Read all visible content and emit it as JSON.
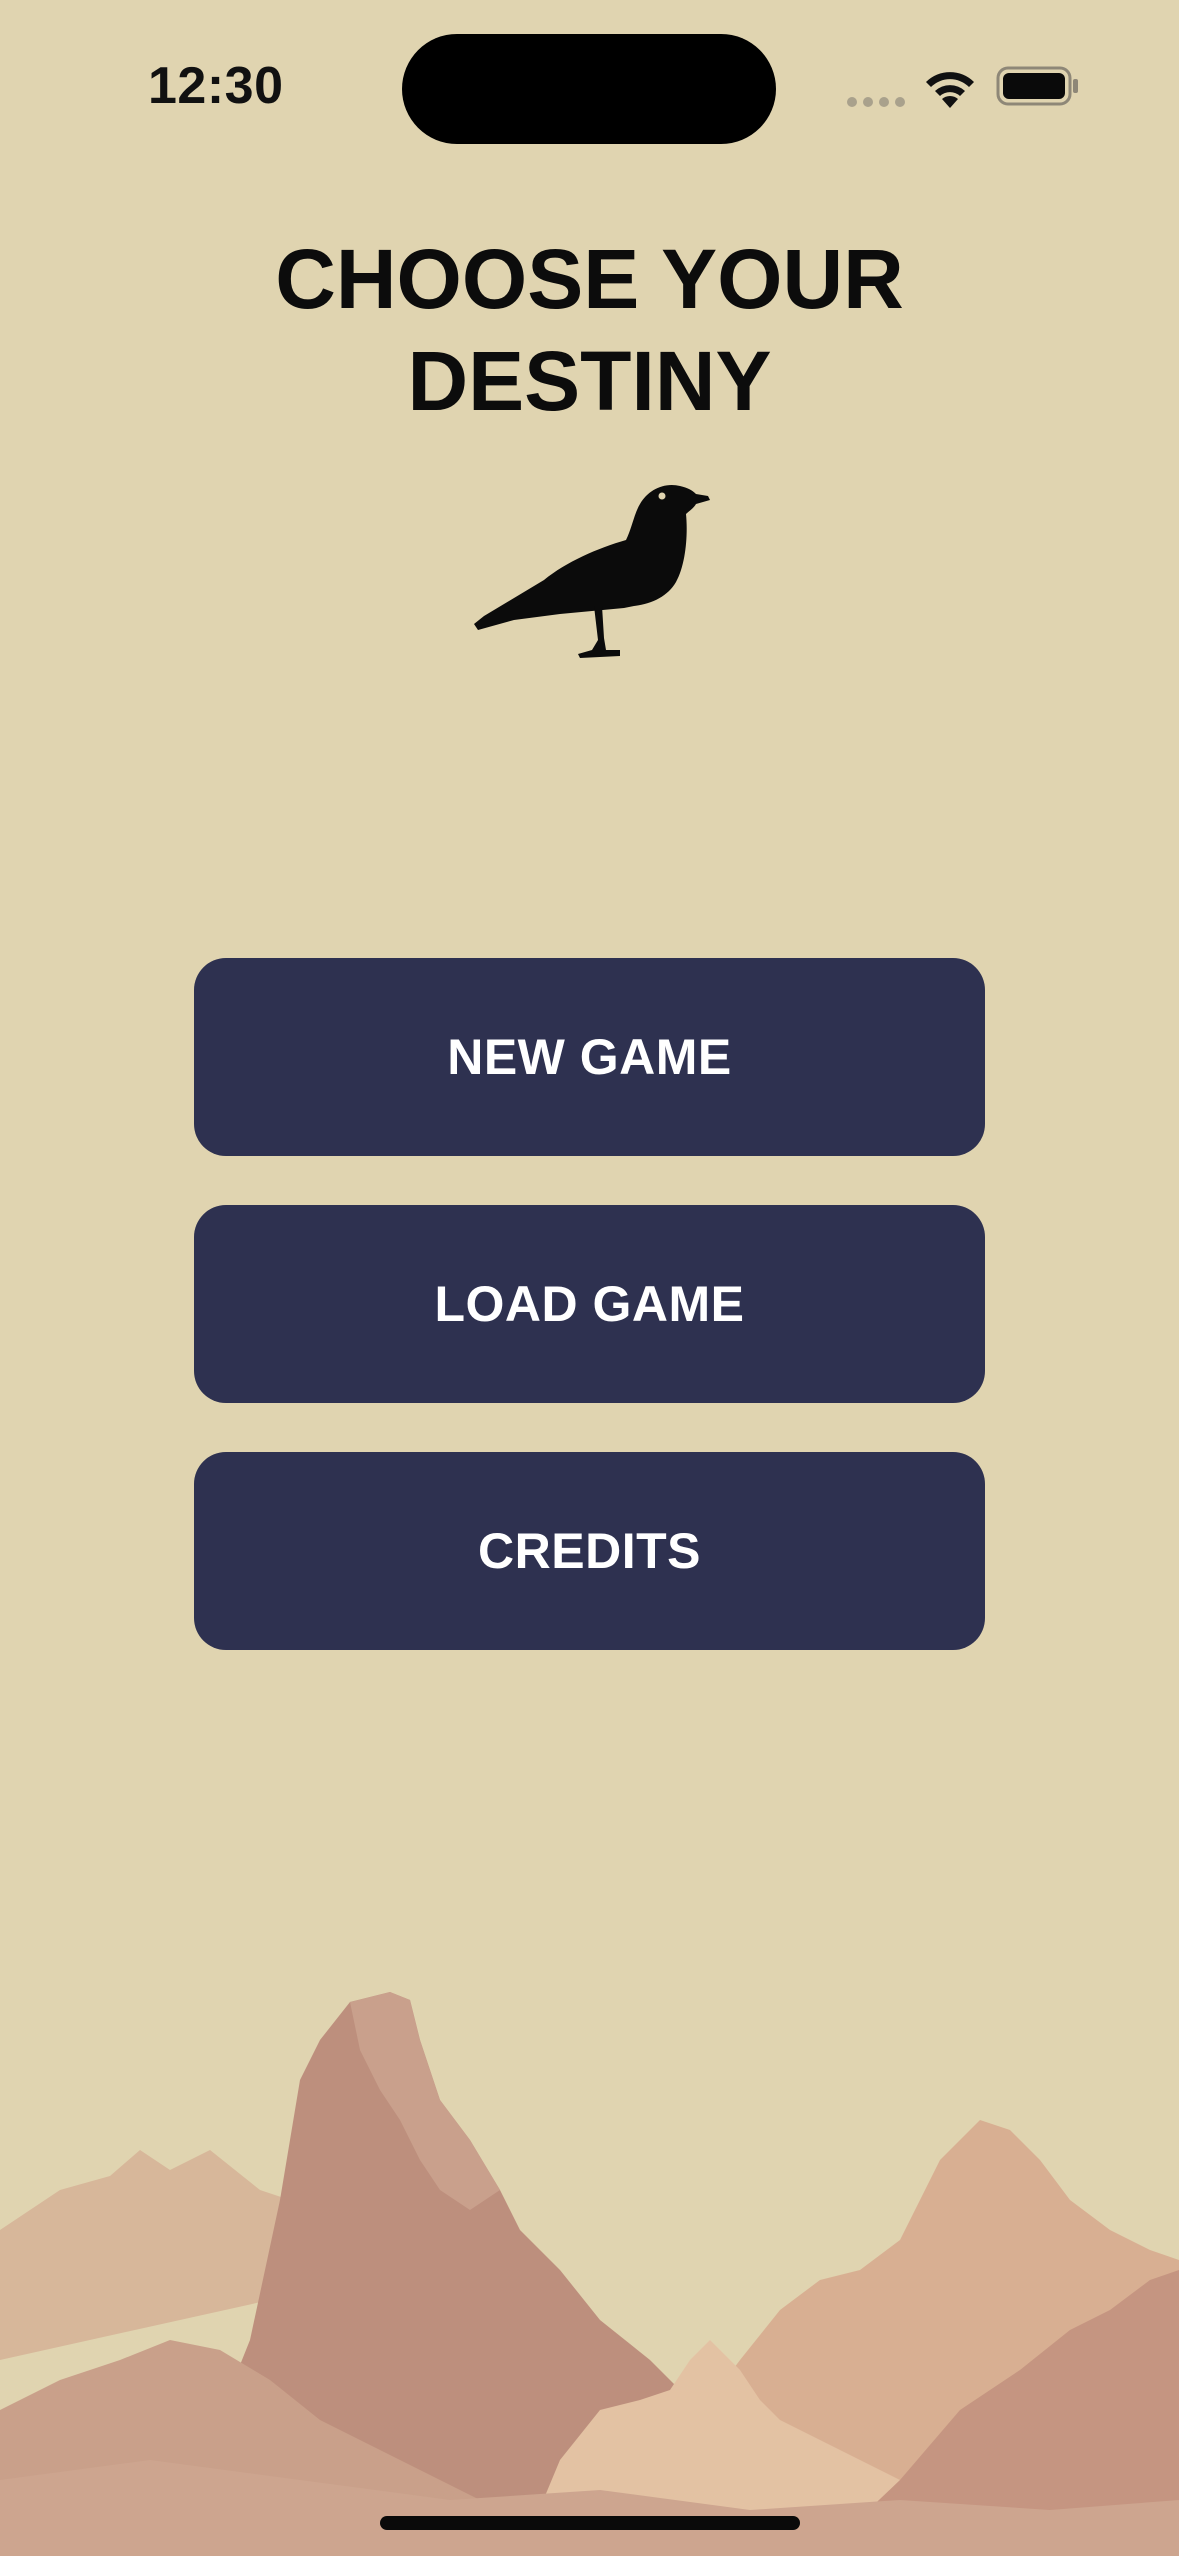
{
  "status_bar": {
    "time": "12:30",
    "icons": [
      "signal-icon",
      "wifi-icon",
      "battery-icon"
    ]
  },
  "title": {
    "line1": "CHOOSE YOUR",
    "line2": "DESTINY"
  },
  "emblem": {
    "icon": "crow-icon"
  },
  "menu": {
    "new_game": "NEW GAME",
    "load_game": "LOAD GAME",
    "credits": "CREDITS"
  },
  "colors": {
    "background": "#E0D4B0",
    "button": "#2E3150",
    "button_text": "#FFFFFF",
    "title_text": "#0C0C0C",
    "mountain_far": "#DDB896",
    "mountain_mid": "#C9A28A",
    "mountain_peak": "#B98C7A"
  },
  "scenery": {
    "icon": "mountains-illustration"
  }
}
